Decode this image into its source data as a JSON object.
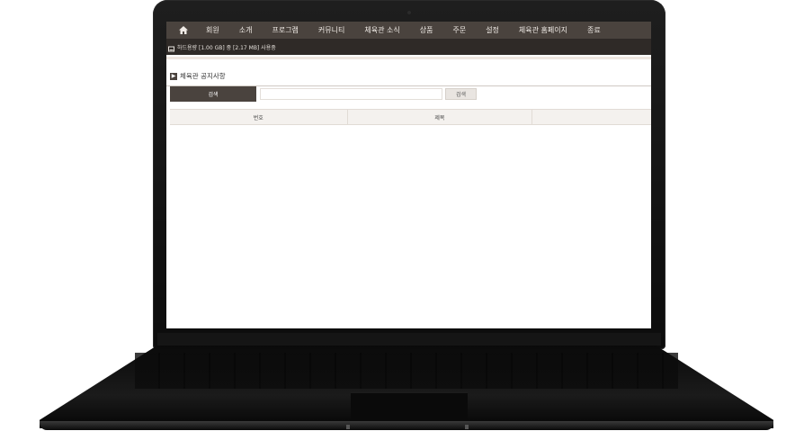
{
  "nav": {
    "home_icon": "home-icon",
    "items": [
      {
        "label": "회원"
      },
      {
        "label": "소개"
      },
      {
        "label": "프로그램"
      },
      {
        "label": "커뮤니티"
      },
      {
        "label": "체육관 소식"
      },
      {
        "label": "상품"
      },
      {
        "label": "주문"
      },
      {
        "label": "설정"
      },
      {
        "label": "체육관 홈페이지"
      },
      {
        "label": "종료"
      }
    ]
  },
  "storage": {
    "icon": "hdd-icon",
    "text": "하드용량 [1.00 GB] 중 [2.17 MB] 사용중"
  },
  "section": {
    "title": "체육관 공지사항"
  },
  "search": {
    "label": "검색",
    "value": "",
    "button": "검색"
  },
  "table": {
    "headers": [
      "번호",
      "제목",
      ""
    ]
  },
  "colors": {
    "nav_bg": "#4a433e",
    "subbar_bg": "#2f2a27",
    "accent": "#4a433e"
  }
}
